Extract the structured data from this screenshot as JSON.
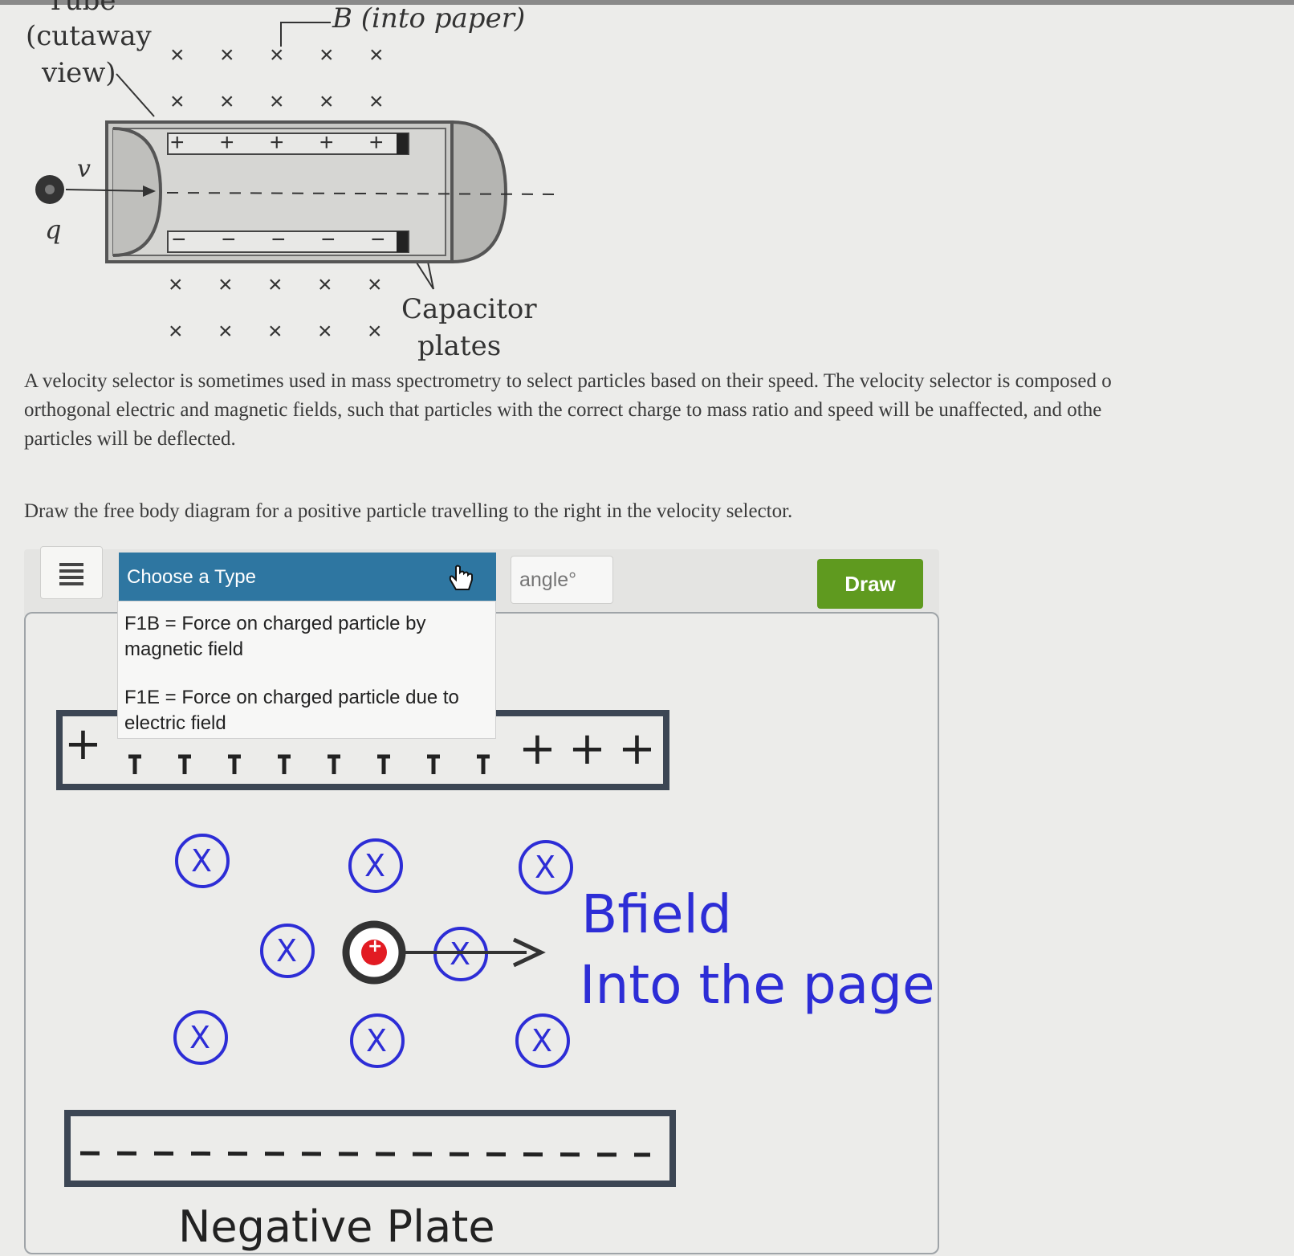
{
  "header_diagram": {
    "tube_label": "Tube",
    "cutaway_label_line1": "(cutaway",
    "cutaway_label_line2": "view)",
    "b_field_label": "B (into paper)",
    "velocity_label": "v",
    "charge_label": "q",
    "capacitor_label_line1": "Capacitor",
    "capacitor_label_line2": "plates",
    "x_symbol": "×",
    "plus_symbol": "+",
    "minus_symbol": "−"
  },
  "description": {
    "line1": "A velocity selector is sometimes used in mass spectrometry to select particles based on their speed. The velocity selector is composed o",
    "line2": "orthogonal electric and magnetic fields, such that particles with the correct charge to mass ratio and speed will be unaffected, and othe",
    "line3": "particles will be deflected."
  },
  "instruction": "Draw the free body diagram for a positive particle travelling to the right in the velocity selector.",
  "toolbar": {
    "menu_icon": "menu-icon",
    "dropdown_label": "Choose a Type",
    "angle_placeholder": "angle°",
    "draw_label": "Draw",
    "draw_color": "#5f9a1f",
    "dropdown_color": "#2e76a1"
  },
  "dropdown_options": [
    {
      "line1": "F1B = Force on charged particle by",
      "line2": "magnetic field"
    },
    {
      "line1": "F1E = Force on charged particle due to",
      "line2": "electric field"
    }
  ],
  "canvas": {
    "positive_plate_symbol": "+",
    "negative_plate_label": "Negative Plate",
    "field_label_line1": "Bfield",
    "field_label_line2": "Into the page",
    "field_marker": "X",
    "particle_sign": "+",
    "field_color": "#2d2dd6",
    "particle_color": "#e21b23"
  }
}
